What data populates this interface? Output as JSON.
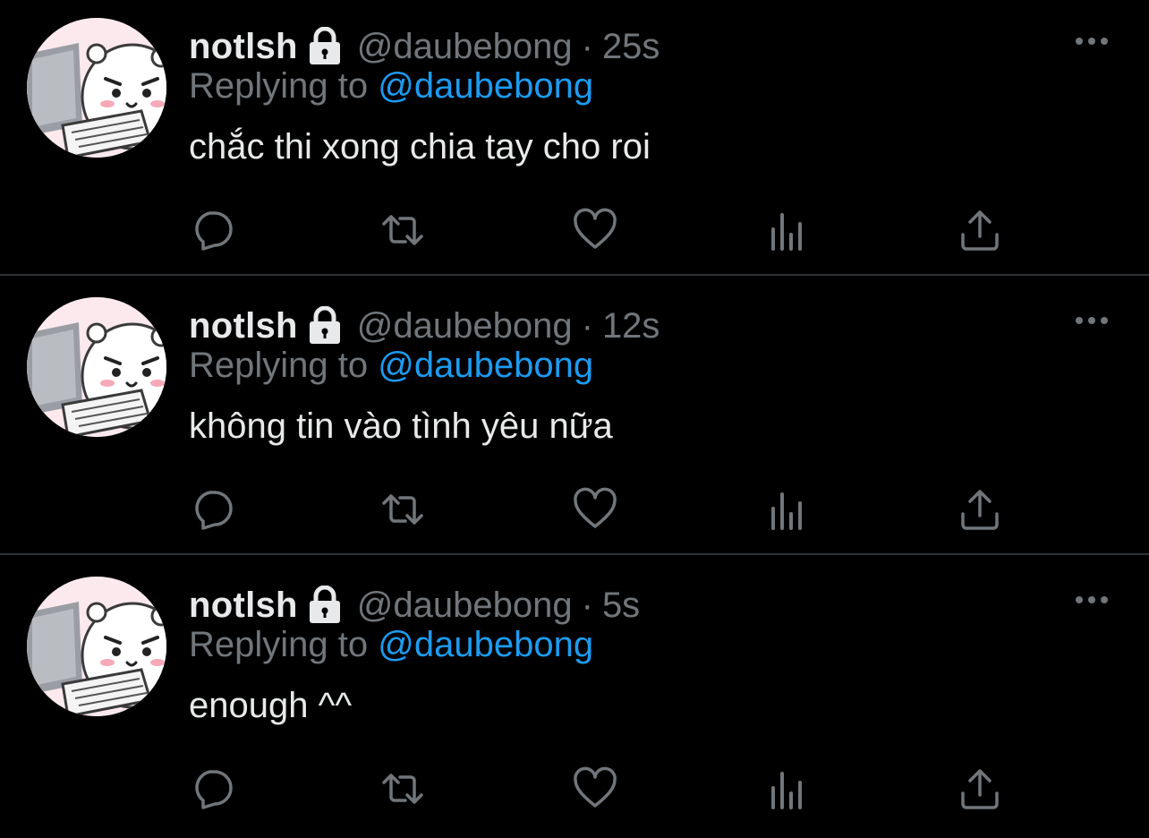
{
  "colors": {
    "background": "#000000",
    "text": "#e7e9ea",
    "secondary": "#71767b",
    "link": "#1d9bf0",
    "divider": "#2f3336"
  },
  "tweets": [
    {
      "name": "notlsh",
      "handle": "@daubebong",
      "separator": "·",
      "time": "25s",
      "replying_prefix": "Replying to",
      "replying_to": "@daubebong",
      "text": "chắc thi xong chia tay cho roi",
      "icons": {
        "lock": "lock-icon",
        "more": "more-icon",
        "reply": "reply-icon",
        "retweet": "retweet-icon",
        "like": "like-icon",
        "views": "views-icon",
        "share": "share-icon"
      }
    },
    {
      "name": "notlsh",
      "handle": "@daubebong",
      "separator": "·",
      "time": "12s",
      "replying_prefix": "Replying to",
      "replying_to": "@daubebong",
      "text": "không tin vào tình yêu nữa",
      "icons": {
        "lock": "lock-icon",
        "more": "more-icon",
        "reply": "reply-icon",
        "retweet": "retweet-icon",
        "like": "like-icon",
        "views": "views-icon",
        "share": "share-icon"
      }
    },
    {
      "name": "notlsh",
      "handle": "@daubebong",
      "separator": "·",
      "time": "5s",
      "replying_prefix": "Replying to",
      "replying_to": "@daubebong",
      "text": "enough ^^",
      "icons": {
        "lock": "lock-icon",
        "more": "more-icon",
        "reply": "reply-icon",
        "retweet": "retweet-icon",
        "like": "like-icon",
        "views": "views-icon",
        "share": "share-icon"
      }
    }
  ]
}
